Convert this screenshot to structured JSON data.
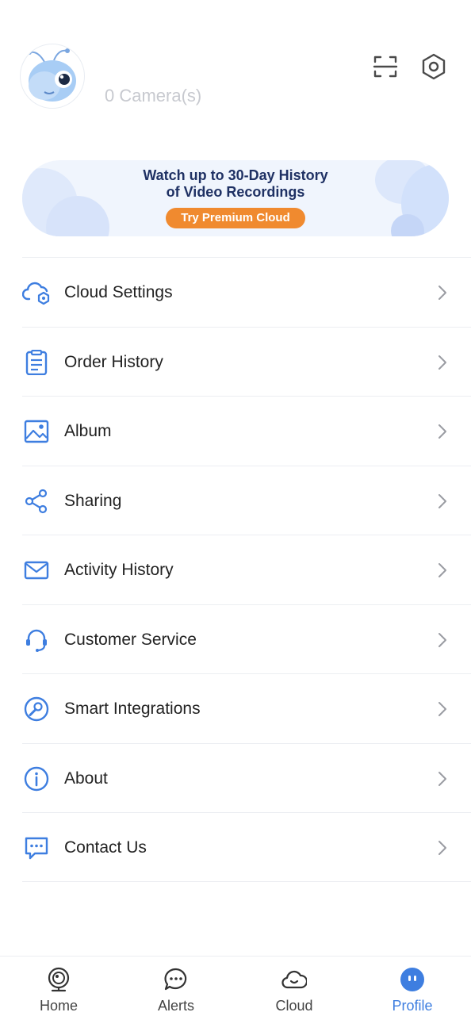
{
  "header": {
    "camera_count": "0 Camera(s)",
    "avatar_icon": "ant-mascot-icon",
    "scan_icon": "scan-icon",
    "settings_icon": "hexagon-gear-icon"
  },
  "banner": {
    "line1": "Watch up to 30-Day History",
    "line2": "of Video Recordings",
    "button": "Try Premium Cloud"
  },
  "menu": [
    {
      "label": "Cloud Settings",
      "icon": "cloud-gear-icon"
    },
    {
      "label": "Order History",
      "icon": "clipboard-icon"
    },
    {
      "label": "Album",
      "icon": "image-icon"
    },
    {
      "label": "Sharing",
      "icon": "share-icon"
    },
    {
      "label": "Activity History",
      "icon": "mail-icon"
    },
    {
      "label": "Customer Service",
      "icon": "headset-icon"
    },
    {
      "label": "Smart Integrations",
      "icon": "wrench-icon"
    },
    {
      "label": "About",
      "icon": "info-icon"
    },
    {
      "label": "Contact Us",
      "icon": "chat-icon"
    }
  ],
  "tabs": [
    {
      "label": "Home",
      "icon": "camera-icon"
    },
    {
      "label": "Alerts",
      "icon": "chat-bubble-icon"
    },
    {
      "label": "Cloud",
      "icon": "cloud-icon"
    },
    {
      "label": "Profile",
      "icon": "profile-face-icon",
      "active": true
    }
  ],
  "colors": {
    "accent": "#3e7ee0",
    "banner_button": "#f08a2f",
    "banner_text": "#1f3164",
    "muted_text": "#c7c9cf"
  }
}
